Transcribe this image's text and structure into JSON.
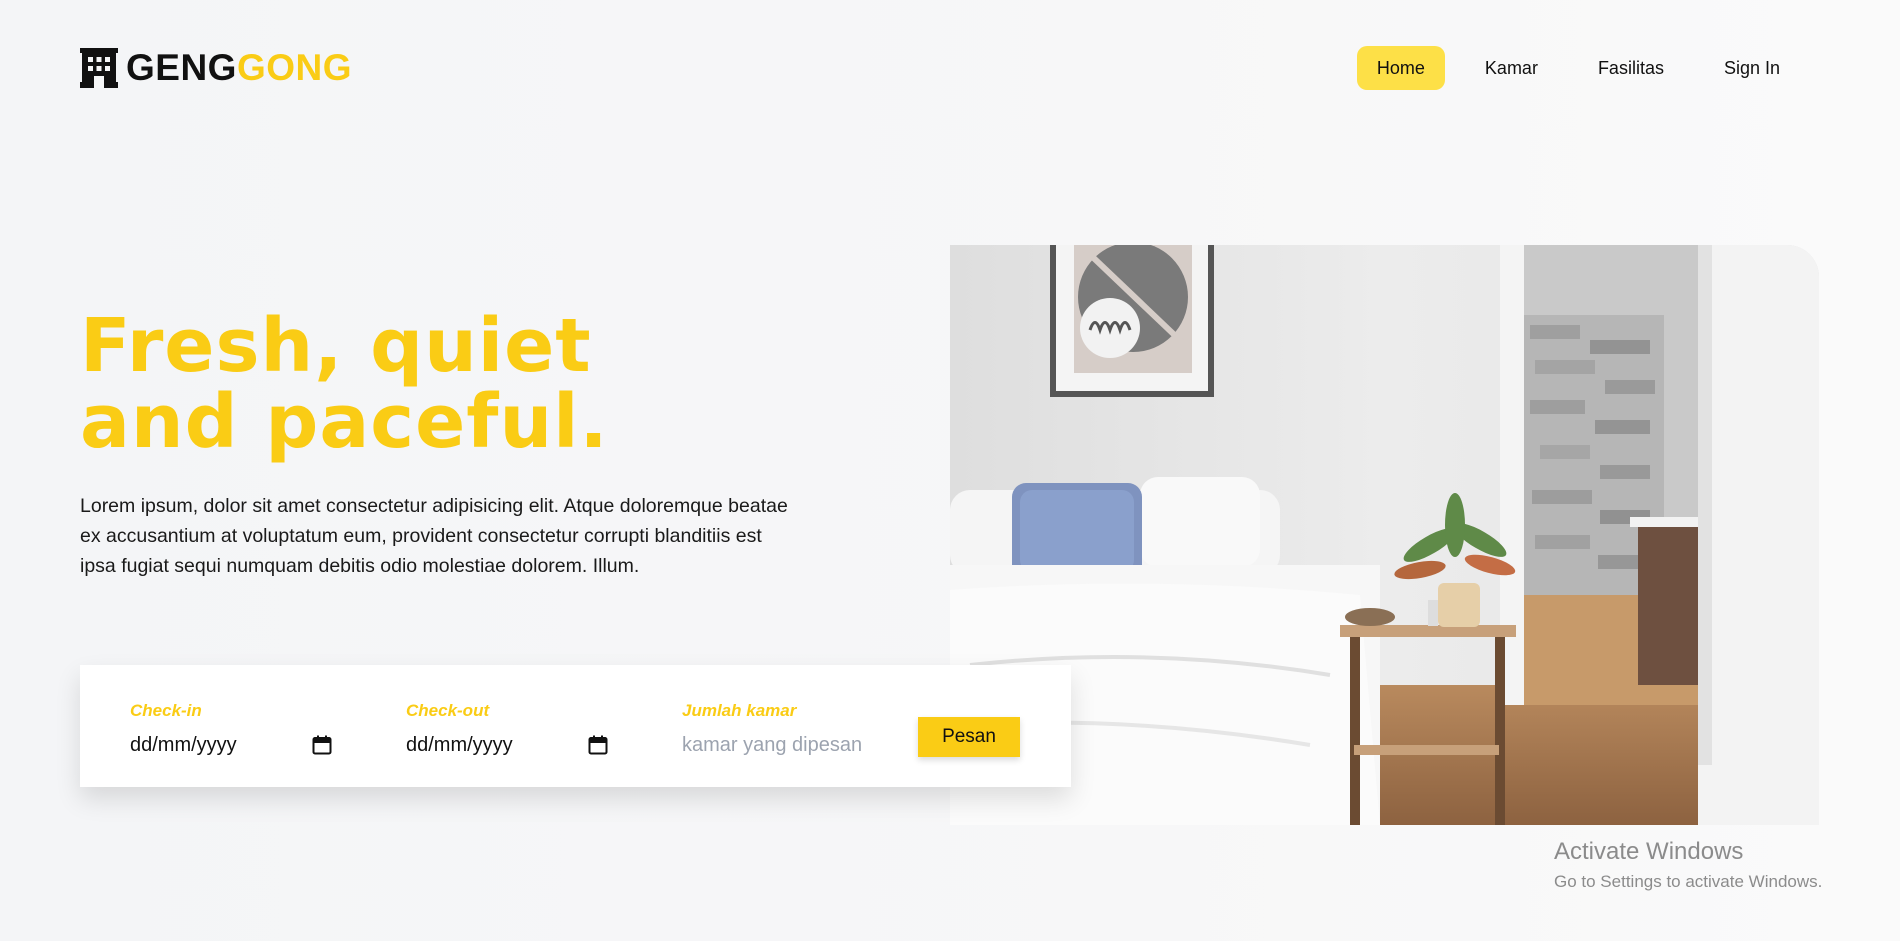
{
  "brand": {
    "name_part1": "GENG",
    "name_part2": "GONG",
    "icon": "building-icon"
  },
  "nav": {
    "items": [
      {
        "label": "Home",
        "active": true
      },
      {
        "label": "Kamar",
        "active": false
      },
      {
        "label": "Fasilitas",
        "active": false
      },
      {
        "label": "Sign In",
        "active": false
      }
    ]
  },
  "hero": {
    "headline_line1": "Fresh, quiet",
    "headline_line2": "and paceful.",
    "description": "Lorem ipsum, dolor sit amet consectetur adipisicing elit. Atque doloremque beatae ex accusantium at voluptatum eum, provident consectetur corrupti blanditiis est ipsa fugiat sequi numquam debitis odio molestiae dolorem. Illum.",
    "image_icon": "bedroom-photo"
  },
  "booking": {
    "checkin_label": "Check-in",
    "checkin_value": "dd/mm/yyyy",
    "checkout_label": "Check-out",
    "checkout_value": "dd/mm/yyyy",
    "rooms_label": "Jumlah kamar",
    "rooms_placeholder": "kamar yang dipesan",
    "submit_label": "Pesan",
    "calendar_icon": "calendar-icon"
  },
  "watermark": {
    "title": "Activate Windows",
    "subtitle": "Go to Settings to activate Windows."
  },
  "colors": {
    "accent": "#facc15",
    "nav_active_bg": "#fde047",
    "background": "#f6f7f8"
  }
}
